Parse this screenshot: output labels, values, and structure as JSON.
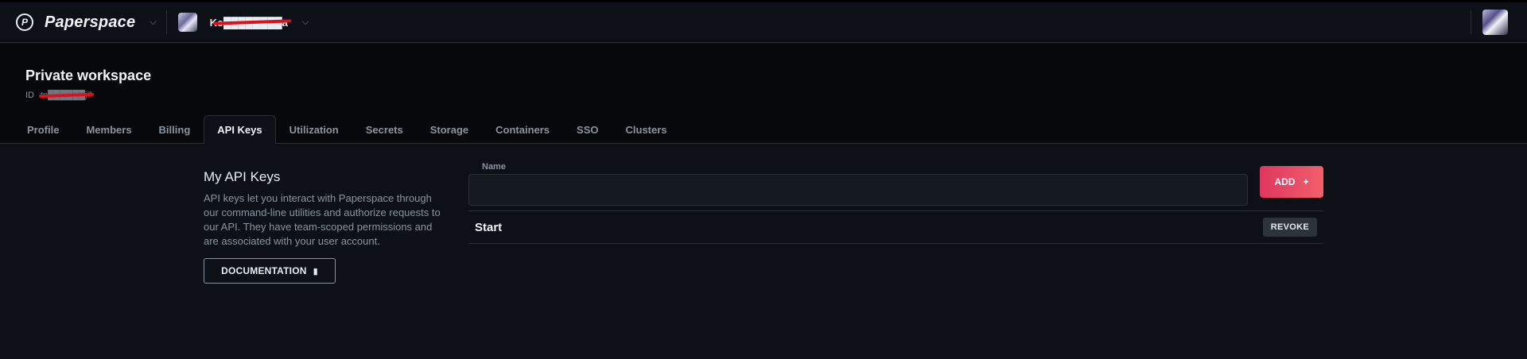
{
  "topbar": {
    "brand_logo_glyph": "P",
    "brand_name": "Paperspace",
    "team_name": "Ko████████a",
    "icons": {
      "brand": "paperspace-logo",
      "dropdown": "chevron-down-icon",
      "team_avatar": "team-avatar",
      "user_avatar": "user-avatar"
    }
  },
  "workspace": {
    "title": "Private workspace",
    "id_label": "ID",
    "id_value": "tn██████j7"
  },
  "tabs": [
    {
      "label": "Profile",
      "active": false
    },
    {
      "label": "Members",
      "active": false
    },
    {
      "label": "Billing",
      "active": false
    },
    {
      "label": "API Keys",
      "active": true
    },
    {
      "label": "Utilization",
      "active": false
    },
    {
      "label": "Secrets",
      "active": false
    },
    {
      "label": "Storage",
      "active": false
    },
    {
      "label": "Containers",
      "active": false
    },
    {
      "label": "SSO",
      "active": false
    },
    {
      "label": "Clusters",
      "active": false
    }
  ],
  "api_keys": {
    "title": "My API Keys",
    "description": "API keys let you interact with Paperspace through our command-line utilities and authorize requests to our API. They have team-scoped permissions and are associated with your user account.",
    "documentation_label": "DOCUMENTATION",
    "name_field": {
      "label": "Name",
      "value": "",
      "placeholder": ""
    },
    "add_label": "ADD",
    "add_icon": "+",
    "keys": [
      {
        "name": "Start",
        "revoke_label": "REVOKE"
      }
    ]
  },
  "colors": {
    "background": "#0d1117",
    "header_background": "#06080b",
    "accent_gradient_start": "#e0365f",
    "accent_gradient_end": "#f0606a",
    "redaction": "#e0101a"
  }
}
